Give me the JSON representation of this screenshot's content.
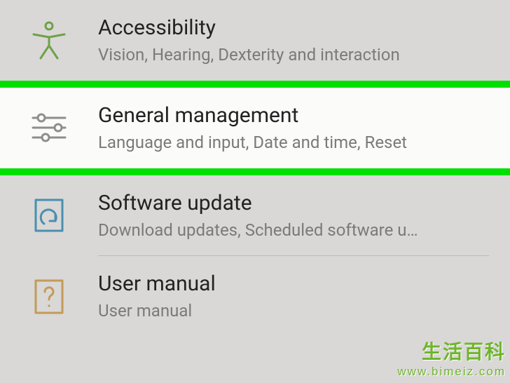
{
  "settings": {
    "items": [
      {
        "title": "Accessibility",
        "subtitle": "Vision, Hearing, Dexterity and interaction",
        "icon": "accessibility-icon",
        "highlighted": false
      },
      {
        "title": "General management",
        "subtitle": "Language and input, Date and time, Reset",
        "icon": "sliders-icon",
        "highlighted": true
      },
      {
        "title": "Software update",
        "subtitle": "Download updates, Scheduled software u…",
        "icon": "update-icon",
        "highlighted": false
      },
      {
        "title": "User manual",
        "subtitle": "User manual",
        "icon": "manual-icon",
        "highlighted": false
      }
    ]
  },
  "colors": {
    "highlight": "#00e000",
    "iconGreen": "#6fa14a",
    "iconGrey": "#8e8e8c",
    "iconBlue": "#4a8fb0",
    "iconOrange": "#c49a5a"
  },
  "watermark": {
    "line1": "生活百科",
    "line2": "www.bimeiz.com"
  }
}
